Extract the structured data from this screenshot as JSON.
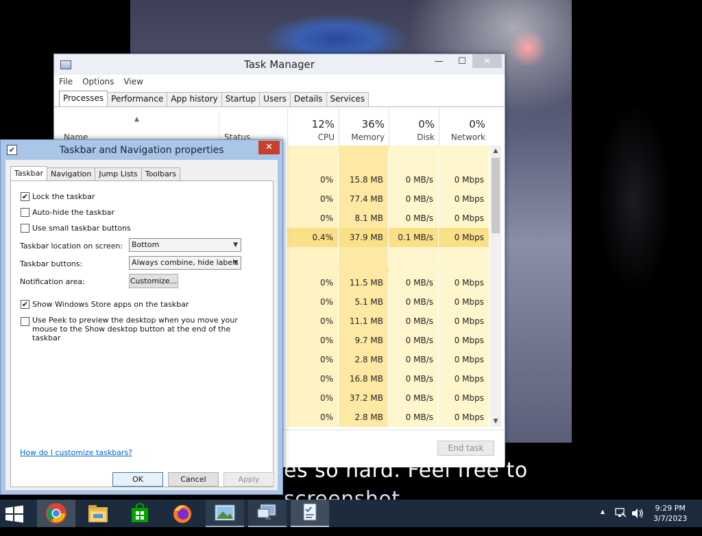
{
  "wallpaper": {
    "caption_line1": "es so hard. Feel free to",
    "caption_line2": "screenshot."
  },
  "task_manager": {
    "title": "Task Manager",
    "window_buttons": {
      "minimize": "—",
      "maximize": "☐",
      "close": "✕"
    },
    "menu": [
      "File",
      "Options",
      "View"
    ],
    "tabs": [
      "Processes",
      "Performance",
      "App history",
      "Startup",
      "Users",
      "Details",
      "Services"
    ],
    "active_tab": "Processes",
    "columns": {
      "name": "Name",
      "status": "Status",
      "cpu": {
        "pct": "12%",
        "label": "CPU"
      },
      "memory": {
        "pct": "36%",
        "label": "Memory"
      },
      "disk": {
        "pct": "0%",
        "label": "Disk"
      },
      "network": {
        "pct": "0%",
        "label": "Network"
      }
    },
    "rows": [
      {
        "cpu": "",
        "memory": "",
        "disk": "",
        "network": ""
      },
      {
        "cpu": "0%",
        "memory": "15.8 MB",
        "disk": "0 MB/s",
        "network": "0 Mbps"
      },
      {
        "cpu": "0%",
        "memory": "77.4 MB",
        "disk": "0 MB/s",
        "network": "0 Mbps"
      },
      {
        "cpu": "0%",
        "memory": "8.1 MB",
        "disk": "0 MB/s",
        "network": "0 Mbps"
      },
      {
        "cpu": "0.4%",
        "memory": "37.9 MB",
        "disk": "0.1 MB/s",
        "network": "0 Mbps"
      },
      {
        "cpu": "",
        "memory": "",
        "disk": "",
        "network": ""
      },
      {
        "cpu": "0%",
        "memory": "11.5 MB",
        "disk": "0 MB/s",
        "network": "0 Mbps"
      },
      {
        "cpu": "0%",
        "memory": "5.1 MB",
        "disk": "0 MB/s",
        "network": "0 Mbps"
      },
      {
        "cpu": "0%",
        "memory": "11.1 MB",
        "disk": "0 MB/s",
        "network": "0 Mbps"
      },
      {
        "cpu": "0%",
        "memory": "9.7 MB",
        "disk": "0 MB/s",
        "network": "0 Mbps"
      },
      {
        "cpu": "0%",
        "memory": "2.8 MB",
        "disk": "0 MB/s",
        "network": "0 Mbps"
      },
      {
        "cpu": "0%",
        "memory": "16.8 MB",
        "disk": "0 MB/s",
        "network": "0 Mbps"
      },
      {
        "cpu": "0%",
        "memory": "37.2 MB",
        "disk": "0 MB/s",
        "network": "0 Mbps"
      },
      {
        "cpu": "0%",
        "memory": "2.8 MB",
        "disk": "0 MB/s",
        "network": "0 Mbps"
      }
    ],
    "end_task_label": "End task"
  },
  "taskbar_dialog": {
    "title": "Taskbar and Navigation properties",
    "close": "✕",
    "tabs": [
      "Taskbar",
      "Navigation",
      "Jump Lists",
      "Toolbars"
    ],
    "active_tab": "Taskbar",
    "checkboxes": {
      "lock": {
        "label": "Lock the taskbar",
        "checked": "✔"
      },
      "autohide": {
        "label": "Auto-hide the taskbar",
        "checked": ""
      },
      "small": {
        "label": "Use small taskbar buttons",
        "checked": ""
      },
      "store": {
        "label": "Show Windows Store apps on the taskbar",
        "checked": "✔"
      },
      "peek": {
        "label": "Use Peek to preview the desktop when you move your mouse to the Show desktop button at the end of the taskbar",
        "checked": ""
      }
    },
    "location_label": "Taskbar location on screen:",
    "location_value": "Bottom",
    "buttons_label": "Taskbar buttons:",
    "buttons_value": "Always combine, hide labels",
    "notification_label": "Notification area:",
    "customize_label": "Customize...",
    "help_link": "How do I customize taskbars?",
    "ok_label": "OK",
    "cancel_label": "Cancel",
    "apply_label": "Apply"
  },
  "taskbar": {
    "clock_time": "9:29 PM",
    "clock_date": "3/7/2023",
    "tray_arrow": "▲"
  }
}
